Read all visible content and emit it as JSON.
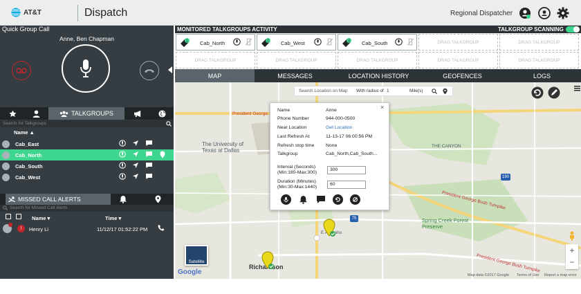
{
  "header": {
    "brand": "AT&T",
    "app_title": "Dispatch",
    "role": "Regional Dispatcher",
    "icons": [
      "status-icon",
      "contacts-icon",
      "settings-icon"
    ]
  },
  "quick_call": {
    "title": "Quick Group Call",
    "participants": "Anne, Ben Chapman",
    "icons": [
      "voicemail-icon",
      "microphone-icon",
      "hangup-icon"
    ]
  },
  "left_tabs": {
    "talkgroups_label": "TALKGROUPS",
    "icons": [
      "star-icon",
      "user-icon",
      "group-icon",
      "megaphone-icon",
      "globe-icon"
    ]
  },
  "talkgroups": {
    "search_placeholder": "Search for Talkgroups",
    "column_name": "Name",
    "rows": [
      {
        "name": "Cab_East",
        "selected": false
      },
      {
        "name": "Cab_North",
        "selected": true
      },
      {
        "name": "Cab_South",
        "selected": false
      },
      {
        "name": "Cab_West",
        "selected": false
      }
    ]
  },
  "missed_calls": {
    "title": "MISSED CALL ALERTS",
    "search_placeholder": "Search for Missed Call Alerts",
    "col_name": "Name",
    "col_time": "Time",
    "rows": [
      {
        "name": "Henry Li",
        "time": "11/12/17 01:52:22 PM"
      }
    ]
  },
  "monitored": {
    "title": "MONITORED TALKGROUPS ACTIVITY",
    "scanning_label": "TALKGROUP SCANNING",
    "scanning_on": true,
    "slots": [
      {
        "name": "Cab_North",
        "badge": "1"
      },
      {
        "name": "Cab_West",
        "badge": "2"
      },
      {
        "name": "Cab_South",
        "badge": "3"
      }
    ],
    "empty_slot_label": "DRAG TALKGROUP"
  },
  "map_tabs": [
    "MAP",
    "MESSAGES",
    "LOCATION HISTORY",
    "GEOFENCES",
    "LOGS"
  ],
  "map": {
    "search_placeholder": "Search Location on Map",
    "radius_label": "With radius of",
    "radius_value": "1",
    "radius_unit": "Mile(s)",
    "satellite_label": "Satellite",
    "google_label": "Google",
    "attribution": "Map data ©2017 Google",
    "terms": "Terms of Use",
    "report": "Report a map error",
    "labels": {
      "president_george_1": "President George",
      "university": "The University of Texas at Dallas",
      "the_canyon": "THE CANYON",
      "richardson": "Richardson",
      "spring_creek": "Spring Creek Forest Preserve",
      "pgbt_1": "President George Bush Turnpike",
      "pgbt_2": "President George Bush Turnpike",
      "e_arapaho": "E Arapaho",
      "hwy75": "75",
      "hwy190": "190"
    }
  },
  "popup": {
    "rows": [
      {
        "label": "Name",
        "value": "Anne"
      },
      {
        "label": "Phone Number",
        "value": "944-000-0500"
      },
      {
        "label": "Near Location",
        "value": "Get Location"
      },
      {
        "label": "Last Refresh At",
        "value": "11-13-17 06:00:56 PM"
      },
      {
        "label": "Refresh stop time",
        "value": "None"
      },
      {
        "label": "Talkgroup",
        "value": "Cab_North,Cab_South..."
      }
    ],
    "interval_label_1": "Interval (Seconds)",
    "interval_label_2": "(Min:180-Max:300)",
    "interval_value": "300",
    "duration_label_1": "Duration (Minutes)",
    "duration_label_2": "(Min:30-Max:1440)",
    "duration_value": "60",
    "close": "×"
  },
  "colors": {
    "header_bg": "#eceeee",
    "panel_bg": "#363d42",
    "tab_bar": "#1f2427",
    "selected_row": "#3ed58f",
    "missed_red": "#c0262c",
    "link_blue": "#2a6ebb"
  }
}
